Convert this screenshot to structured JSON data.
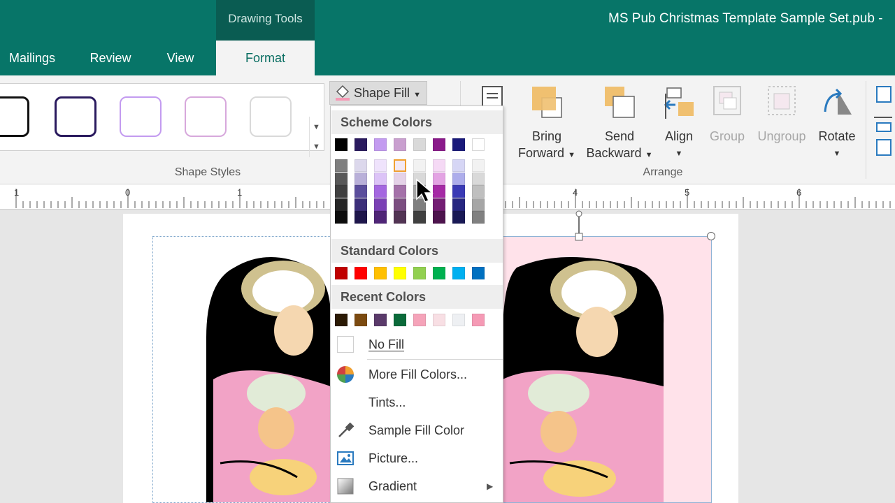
{
  "window": {
    "context_tab_label": "Drawing Tools",
    "document_title": "MS Pub Christmas Template Sample Set.pub  -"
  },
  "tabs": [
    {
      "label": "Mailings"
    },
    {
      "label": "Review"
    },
    {
      "label": "View"
    },
    {
      "label": "Format",
      "active": true
    }
  ],
  "ribbon": {
    "shape_styles_label": "Shape Styles",
    "arrange_label": "Arrange",
    "shape_fill_label": "Shape Fill",
    "buttons": {
      "bring_forward_1": "Bring",
      "bring_forward_2": "Forward",
      "send_backward_1": "Send",
      "send_backward_2": "Backward",
      "align": "Align",
      "group": "Group",
      "ungroup": "Ungroup",
      "rotate": "Rotate"
    }
  },
  "ruler": {
    "labels": [
      "1",
      "0",
      "1",
      "4",
      "5",
      "6"
    ]
  },
  "menu": {
    "scheme_colors_label": "Scheme Colors",
    "standard_colors_label": "Standard Colors",
    "recent_colors_label": "Recent Colors",
    "no_fill_label": "No Fill",
    "more_fill_colors_label": "More Fill Colors...",
    "tints_label": "Tints...",
    "sample_fill_label": "Sample Fill Color",
    "picture_label": "Picture...",
    "gradient_label": "Gradient",
    "scheme_top": [
      "#000000",
      "#2a1a5e",
      "#c39bf0",
      "#c99fcf",
      "#d9d9d9",
      "#8a1a8a",
      "#1a1a7a",
      "#ffffff"
    ],
    "scheme_columns": [
      [
        "#7f7f7f",
        "#595959",
        "#404040",
        "#262626",
        "#0d0d0d"
      ],
      [
        "#dcd8ec",
        "#b9b0d9",
        "#5b4e9c",
        "#3c2f7a",
        "#1e164b"
      ],
      [
        "#efe3fc",
        "#dcc3f7",
        "#a467e0",
        "#7a40b5",
        "#4f2577"
      ],
      [
        "#f3e9f4",
        "#e5d2e8",
        "#a471a9",
        "#7b4e80",
        "#523454"
      ],
      [
        "#f2f2f2",
        "#d9d9d9",
        "#a6a6a6",
        "#7f7f7f",
        "#404040"
      ],
      [
        "#f5d9f5",
        "#e3a3e3",
        "#a52aa5",
        "#731d73",
        "#4d134d"
      ],
      [
        "#d6d6f5",
        "#adadeb",
        "#3a3ab5",
        "#262680",
        "#191955"
      ],
      [
        "#f2f2f2",
        "#d9d9d9",
        "#bfbfbf",
        "#a6a6a6",
        "#808080"
      ]
    ],
    "standard": [
      "#c00000",
      "#ff0000",
      "#ffc000",
      "#ffff00",
      "#92d050",
      "#00b050",
      "#00b0f0",
      "#0070c0"
    ],
    "recent": [
      "#2b1a05",
      "#7b4a10",
      "#5a3a6a",
      "#0b6a3a",
      "#f5a3b9",
      "#f8dfe4",
      "#eef0f3",
      "#f59ab5"
    ]
  },
  "colors": {
    "title_bar": "#077568",
    "context_tab": "#0a5c52",
    "selected_fill": "#ffe2ea"
  }
}
